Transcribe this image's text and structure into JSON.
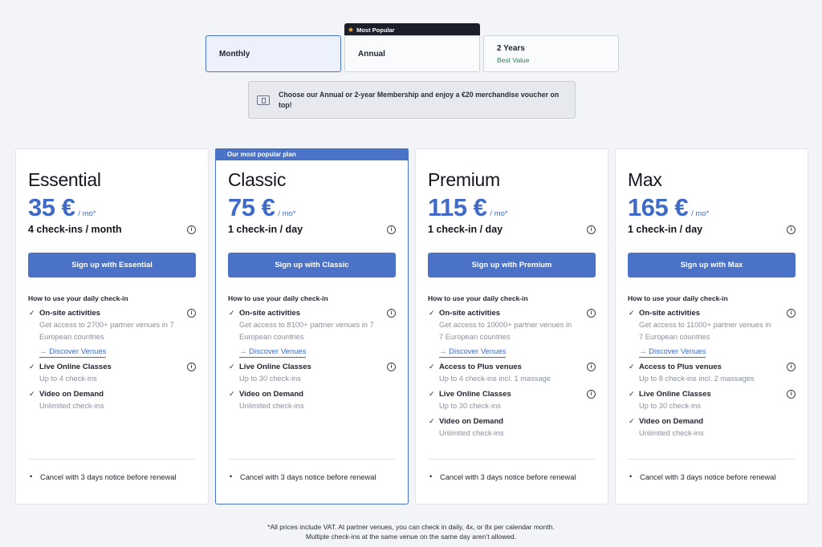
{
  "billing": {
    "options": [
      {
        "label": "Monthly",
        "sub": ""
      },
      {
        "label": "Annual",
        "sub": ""
      },
      {
        "label": "2 Years",
        "sub": "Best Value"
      }
    ],
    "popular_tag": "Most Popular",
    "selected": "Monthly"
  },
  "promo": {
    "text": "Choose our Annual or 2-year Membership and enjoy a €20 merchandise voucher on top!"
  },
  "plans": [
    {
      "banner": "",
      "name": "Essential",
      "price": "35 €",
      "per": "/ mo*",
      "checkins": "4 check-ins / month",
      "signup": "Sign up with Essential",
      "howto": "How to use your daily check-in",
      "features": [
        {
          "title": "On-site activities",
          "desc": "Get access to 2700+ partner venues in 7 European countries",
          "link": "→ Discover Venues"
        },
        {
          "title": "Live Online Classes",
          "desc": "Up to 4 check-ins"
        },
        {
          "title": "Video on Demand",
          "desc": "Unlimited check-ins"
        }
      ],
      "cancel": "Cancel with 3 days notice before renewal"
    },
    {
      "banner": "Our most popular plan",
      "name": "Classic",
      "price": "75 €",
      "per": "/ mo*",
      "checkins": "1 check-in / day",
      "signup": "Sign up with Classic",
      "howto": "How to use your daily check-in",
      "features": [
        {
          "title": "On-site activities",
          "desc": "Get access to 8100+ partner venues in 7 European countries",
          "link": "→ Discover Venues"
        },
        {
          "title": "Live Online Classes",
          "desc": "Up to 30 check-ins"
        },
        {
          "title": "Video on Demand",
          "desc": "Unlimited check-ins"
        }
      ],
      "cancel": "Cancel with 3 days notice before renewal"
    },
    {
      "banner": "",
      "name": "Premium",
      "price": "115 €",
      "per": "/ mo*",
      "checkins": "1 check-in / day",
      "signup": "Sign up with Premium",
      "howto": "How to use your daily check-in",
      "features": [
        {
          "title": "On-site activities",
          "desc": "Get access to 10000+ partner venues in 7 European countries",
          "link": "→ Discover Venues"
        },
        {
          "title": "Access to Plus venues",
          "desc": "Up to 4 check-ins incl. 1 massage"
        },
        {
          "title": "Live Online Classes",
          "desc": "Up to 30 check-ins"
        },
        {
          "title": "Video on Demand",
          "desc": "Unlimited check-ins"
        }
      ],
      "cancel": "Cancel with 3 days notice before renewal"
    },
    {
      "banner": "",
      "name": "Max",
      "price": "165 €",
      "per": "/ mo*",
      "checkins": "1 check-in / day",
      "signup": "Sign up with Max",
      "howto": "How to use your daily check-in",
      "features": [
        {
          "title": "On-site activities",
          "desc": "Get access to 11000+ partner venues in 7 European countries",
          "link": "→ Discover Venues"
        },
        {
          "title": "Access to Plus venues",
          "desc": "Up to 8 check-ins incl. 2 massages"
        },
        {
          "title": "Live Online Classes",
          "desc": "Up to 30 check-ins"
        },
        {
          "title": "Video on Demand",
          "desc": "Unlimited check-ins"
        }
      ],
      "cancel": "Cancel with 3 days notice before renewal"
    }
  ],
  "footnote": {
    "line1": "*All prices include VAT. At partner venues, you can check in daily, 4x, or 8x per calendar month.",
    "line2": "Multiple check-ins at the same venue on the same day aren’t allowed."
  },
  "icons": {
    "info": "info-icon",
    "check": "check-icon",
    "star": "star-icon",
    "voucher": "voucher-icon"
  },
  "colors": {
    "accent": "#4a73c7",
    "price": "#3f6bc7",
    "best_value": "#2e7d55"
  }
}
